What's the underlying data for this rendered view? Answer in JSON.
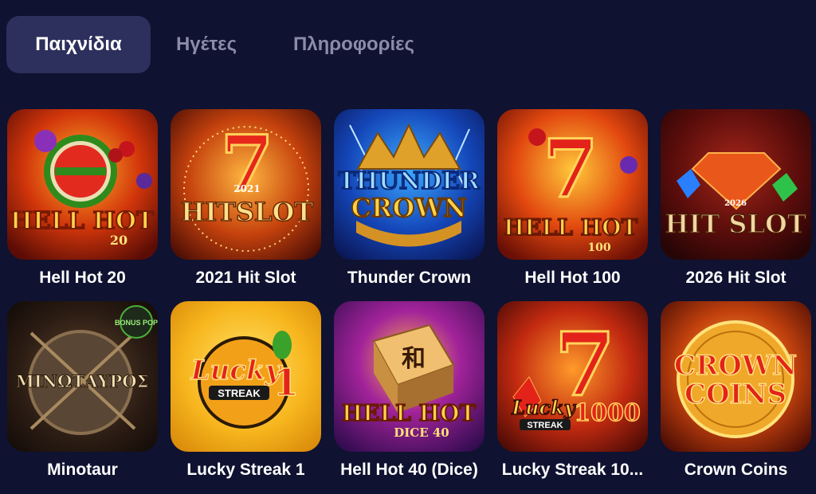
{
  "tabs": [
    {
      "label": "Παιχνίδια",
      "active": true
    },
    {
      "label": "Ηγέτες",
      "active": false
    },
    {
      "label": "Πληροφορίες",
      "active": false
    }
  ],
  "games": [
    {
      "title": "Hell Hot 20",
      "logo": [
        "HELL HOT",
        "20"
      ],
      "icon": "watermelon-icon"
    },
    {
      "title": "2021 Hit Slot",
      "logo": [
        "HITSLOT",
        "2021"
      ],
      "icon": "seven-icon"
    },
    {
      "title": "Thunder Crown",
      "logo": [
        "THUNDER",
        "CROWN"
      ],
      "icon": "crown-icon"
    },
    {
      "title": "Hell Hot 100",
      "logo": [
        "HELL HOT",
        "100"
      ],
      "icon": "seven-icon"
    },
    {
      "title": "2026 Hit Slot",
      "logo": [
        "HIT SLOT",
        "2026"
      ],
      "icon": "diamond-icon"
    },
    {
      "title": "Minotaur",
      "logo": [
        "ΜΙΝΩΤΑΥΡΟΣ",
        "BONUS POP"
      ],
      "icon": "shield-icon"
    },
    {
      "title": "Lucky Streak 1",
      "logo": [
        "Lucky",
        "STREAK",
        "1"
      ],
      "icon": "lemon-icon"
    },
    {
      "title": "Hell Hot 40 (Dice)",
      "logo": [
        "HELL HOT",
        "DICE 40",
        "和"
      ],
      "icon": "dice-icon"
    },
    {
      "title": "Lucky Streak 10...",
      "logo": [
        "Lucky",
        "STREAK",
        "1000"
      ],
      "icon": "seven-icon"
    },
    {
      "title": "Crown Coins",
      "logo": [
        "CROWN",
        "COINS"
      ],
      "icon": "coin-icon"
    }
  ]
}
